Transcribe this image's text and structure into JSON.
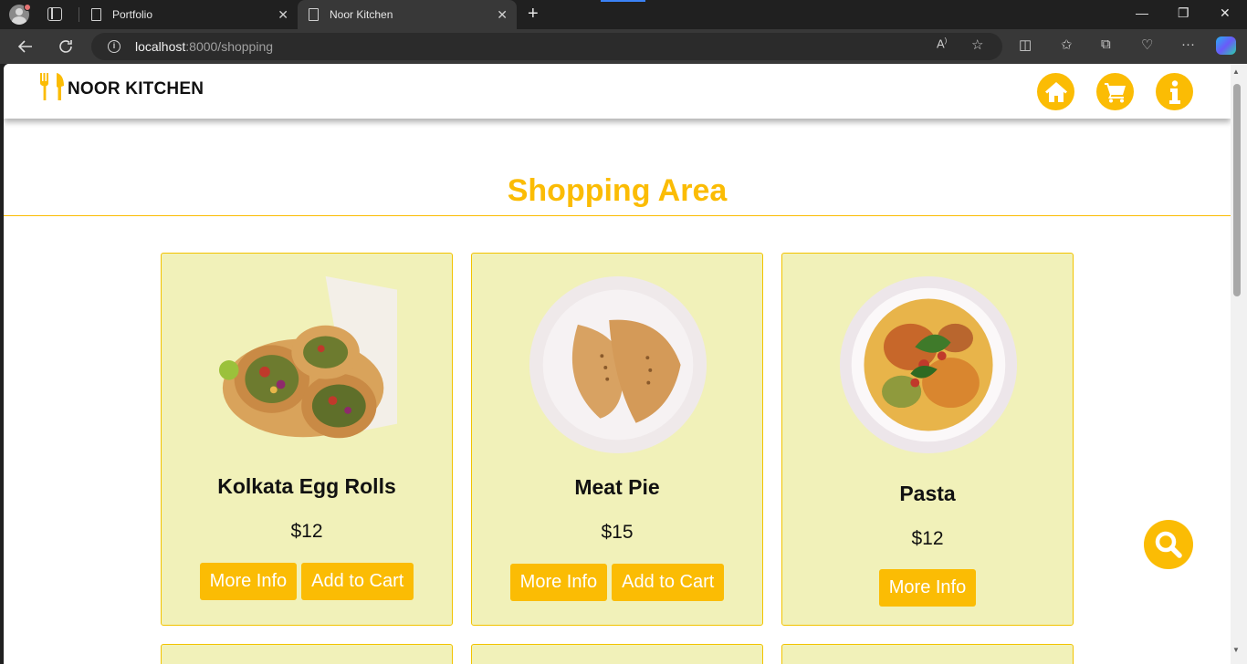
{
  "browser": {
    "tabs": [
      {
        "title": "Portfolio",
        "active": false
      },
      {
        "title": "Noor Kitchen",
        "active": true
      }
    ],
    "url_host": "localhost",
    "url_path": ":8000/shopping"
  },
  "site": {
    "brand": "NOOR KITCHEN",
    "nav": [
      "home-icon",
      "cart-icon",
      "info-icon"
    ],
    "accent_color": "#fbbc04",
    "card_bg": "#f1f1b9"
  },
  "page": {
    "title": "Shopping Area"
  },
  "products": [
    {
      "name": "Kolkata Egg Rolls",
      "price": "$12",
      "more_label": "More Info",
      "cart_label": "Add to Cart"
    },
    {
      "name": "Meat Pie",
      "price": "$15",
      "more_label": "More Info",
      "cart_label": "Add to Cart"
    },
    {
      "name": "Pasta",
      "price": "$12",
      "more_label": "More Info"
    }
  ]
}
